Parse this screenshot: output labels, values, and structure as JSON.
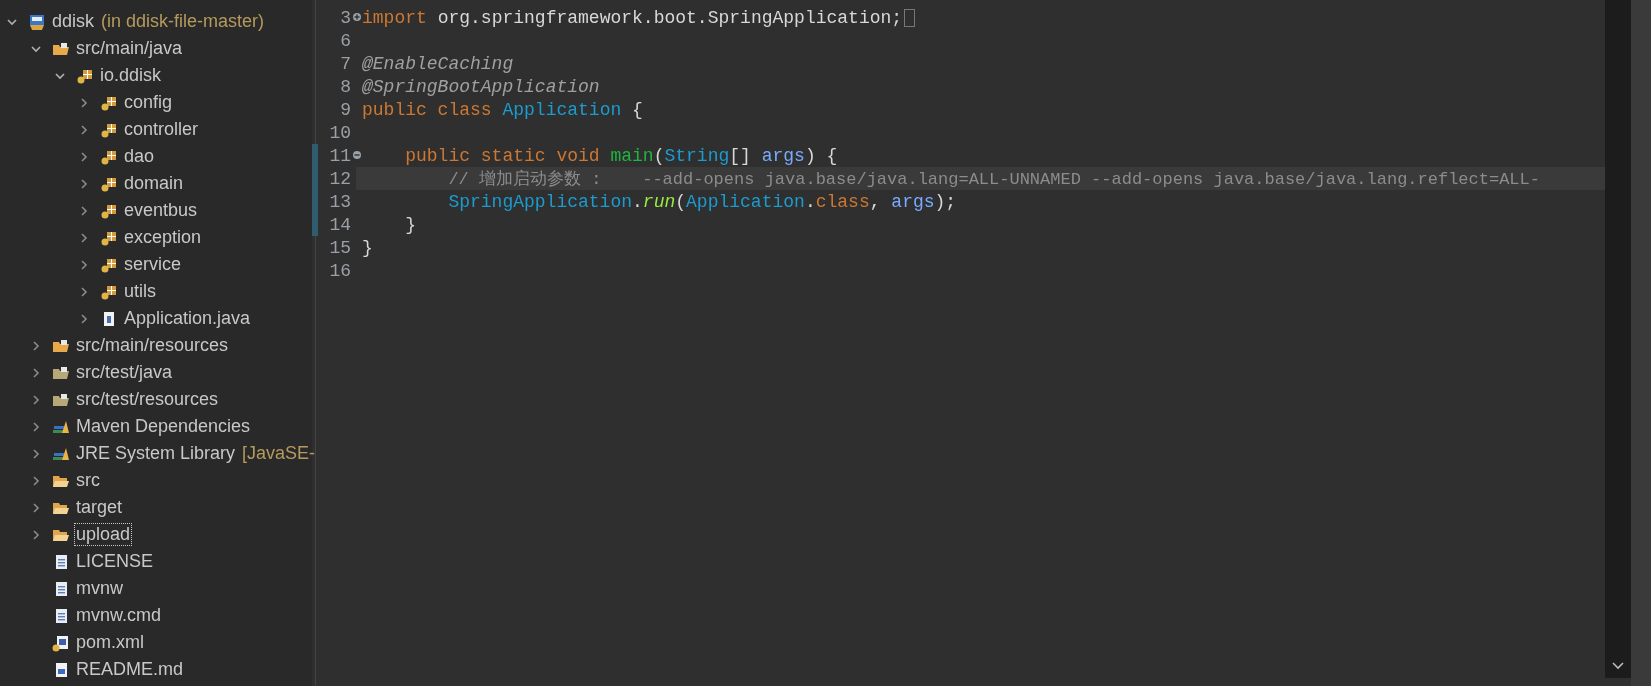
{
  "project_tree": [
    {
      "name": "ddisk",
      "location": "(in ddisk-file-master)",
      "kind": "project",
      "expanded": true,
      "selected": false,
      "children": [
        {
          "name": "src/main/java",
          "kind": "source-folder",
          "expanded": true,
          "selected": false,
          "children": [
            {
              "name": "io.ddisk",
              "kind": "package",
              "expanded": true,
              "selected": false,
              "children": [
                {
                  "name": "config",
                  "kind": "package",
                  "expanded": false,
                  "selected": false
                },
                {
                  "name": "controller",
                  "kind": "package",
                  "expanded": false,
                  "selected": false
                },
                {
                  "name": "dao",
                  "kind": "package",
                  "expanded": false,
                  "selected": false
                },
                {
                  "name": "domain",
                  "kind": "package",
                  "expanded": false,
                  "selected": false
                },
                {
                  "name": "eventbus",
                  "kind": "package",
                  "expanded": false,
                  "selected": false
                },
                {
                  "name": "exception",
                  "kind": "package",
                  "expanded": false,
                  "selected": false
                },
                {
                  "name": "service",
                  "kind": "package",
                  "expanded": false,
                  "selected": false
                },
                {
                  "name": "utils",
                  "kind": "package",
                  "expanded": false,
                  "selected": false
                },
                {
                  "name": "Application.java",
                  "kind": "java-file",
                  "expanded": false,
                  "selected": false
                }
              ]
            }
          ]
        },
        {
          "name": "src/main/resources",
          "kind": "source-folder",
          "expanded": false,
          "selected": false
        },
        {
          "name": "src/test/java",
          "kind": "test-folder",
          "expanded": false,
          "selected": false
        },
        {
          "name": "src/test/resources",
          "kind": "test-folder",
          "expanded": false,
          "selected": false
        },
        {
          "name": "Maven Dependencies",
          "kind": "library",
          "expanded": false,
          "selected": false
        },
        {
          "name": "JRE System Library",
          "location": "[JavaSE-",
          "kind": "library",
          "expanded": false,
          "selected": false
        },
        {
          "name": "src",
          "kind": "folder",
          "expanded": false,
          "selected": false
        },
        {
          "name": "target",
          "kind": "folder",
          "expanded": false,
          "selected": false
        },
        {
          "name": "upload",
          "kind": "folder",
          "expanded": false,
          "selected": true
        },
        {
          "name": "LICENSE",
          "kind": "text-file",
          "selected": false
        },
        {
          "name": "mvnw",
          "kind": "text-file",
          "selected": false
        },
        {
          "name": "mvnw.cmd",
          "kind": "text-file",
          "selected": false
        },
        {
          "name": "pom.xml",
          "kind": "maven-file",
          "selected": false
        },
        {
          "name": "README.md",
          "kind": "doc-file",
          "selected": false
        }
      ]
    }
  ],
  "editor": {
    "lines": [
      {
        "number": "3",
        "folded": true,
        "changed": false,
        "current": false,
        "tokens": [
          {
            "kind": "keyword",
            "text": "import "
          },
          {
            "kind": "plain",
            "text": "org.springframework.boot.SpringApplication;"
          }
        ]
      },
      {
        "number": "6",
        "changed": false,
        "current": false
      },
      {
        "number": "7",
        "changed": false,
        "current": false,
        "tokens": [
          {
            "kind": "annotation",
            "text": "@EnableCaching"
          }
        ]
      },
      {
        "number": "8",
        "changed": false,
        "current": false,
        "tokens": [
          {
            "kind": "annotation",
            "text": "@SpringBootApplication"
          }
        ]
      },
      {
        "number": "9",
        "changed": false,
        "current": false,
        "tokens": [
          {
            "kind": "keyword",
            "text": "public class "
          },
          {
            "kind": "type",
            "text": "Application"
          },
          {
            "kind": "plain",
            "text": " {"
          }
        ],
        "children": [
          {
            "number": "10",
            "changed": false,
            "current": false
          },
          {
            "number": "11",
            "folded": false,
            "changed": true,
            "current": false,
            "tokens": [
              {
                "kind": "keyword",
                "text": "public static void "
              },
              {
                "kind": "method-decl",
                "text": "main"
              },
              {
                "kind": "plain",
                "text": "("
              },
              {
                "kind": "type",
                "text": "String"
              },
              {
                "kind": "plain",
                "text": "[] "
              },
              {
                "kind": "param",
                "text": "args"
              },
              {
                "kind": "plain",
                "text": ") {"
              }
            ],
            "children": [
              {
                "number": "12",
                "changed": true,
                "current": true,
                "tokens": [
                  {
                    "kind": "comment",
                    "text": "// 增加启动参数 :    --add-opens java.base/java.lang=ALL-UNNAMED --add-opens java.base/java.lang.reflect=ALL-"
                  }
                ]
              },
              {
                "number": "13",
                "changed": true,
                "current": false,
                "tokens": [
                  {
                    "kind": "type",
                    "text": "SpringApplication"
                  },
                  {
                    "kind": "plain",
                    "text": "."
                  },
                  {
                    "kind": "static-call",
                    "text": "run"
                  },
                  {
                    "kind": "plain",
                    "text": "("
                  },
                  {
                    "kind": "type",
                    "text": "Application"
                  },
                  {
                    "kind": "plain",
                    "text": "."
                  },
                  {
                    "kind": "keyword",
                    "text": "class"
                  },
                  {
                    "kind": "plain",
                    "text": ", "
                  },
                  {
                    "kind": "param",
                    "text": "args"
                  },
                  {
                    "kind": "plain",
                    "text": ");"
                  }
                ]
              }
            ]
          },
          {
            "number": "14",
            "changed": true,
            "current": false,
            "tokens": [
              {
                "kind": "plain",
                "text": "}"
              }
            ]
          }
        ]
      },
      {
        "number": "15",
        "changed": false,
        "current": false,
        "tokens": [
          {
            "kind": "plain",
            "text": "}"
          }
        ]
      },
      {
        "number": "16",
        "changed": false,
        "current": false
      }
    ]
  }
}
